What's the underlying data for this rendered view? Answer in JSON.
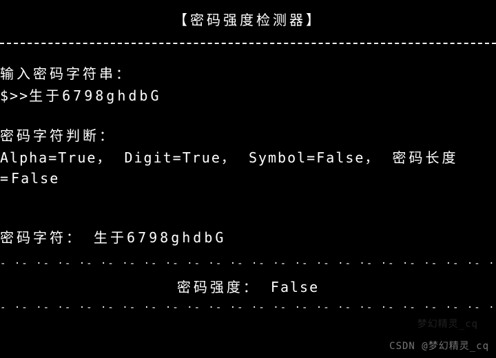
{
  "title": "【密码强度检测器】",
  "input": {
    "label": "输入密码字符串：",
    "prompt_prefix": "$>>",
    "value": "生于6798ghdbG"
  },
  "judge": {
    "label": "密码字符判断：",
    "alpha_key": "Alpha=",
    "alpha_val": "True",
    "digit_key": "Digit=",
    "digit_val": "True",
    "symbol_key": "Symbol=",
    "symbol_val": "False",
    "length_key": "密码长度=",
    "length_val": "False",
    "sep": "，"
  },
  "echo": {
    "label": "密码字符：",
    "value": "生于6798ghdbG"
  },
  "strength": {
    "label": "密码强度：",
    "value": "False"
  },
  "divider_pattern": "- ·- ·- ·- ·- ·- ·- ·- ·- ·- ·- ·- ·- ·- ·- ·- ·- ·- ·- ·- ·- ·- ·- ·- ·- ·- ·- ·- ·- ·- ·- ·-",
  "watermark_main": "CSDN @梦幻精灵_cq",
  "watermark_faint": "梦幻精灵_cq"
}
